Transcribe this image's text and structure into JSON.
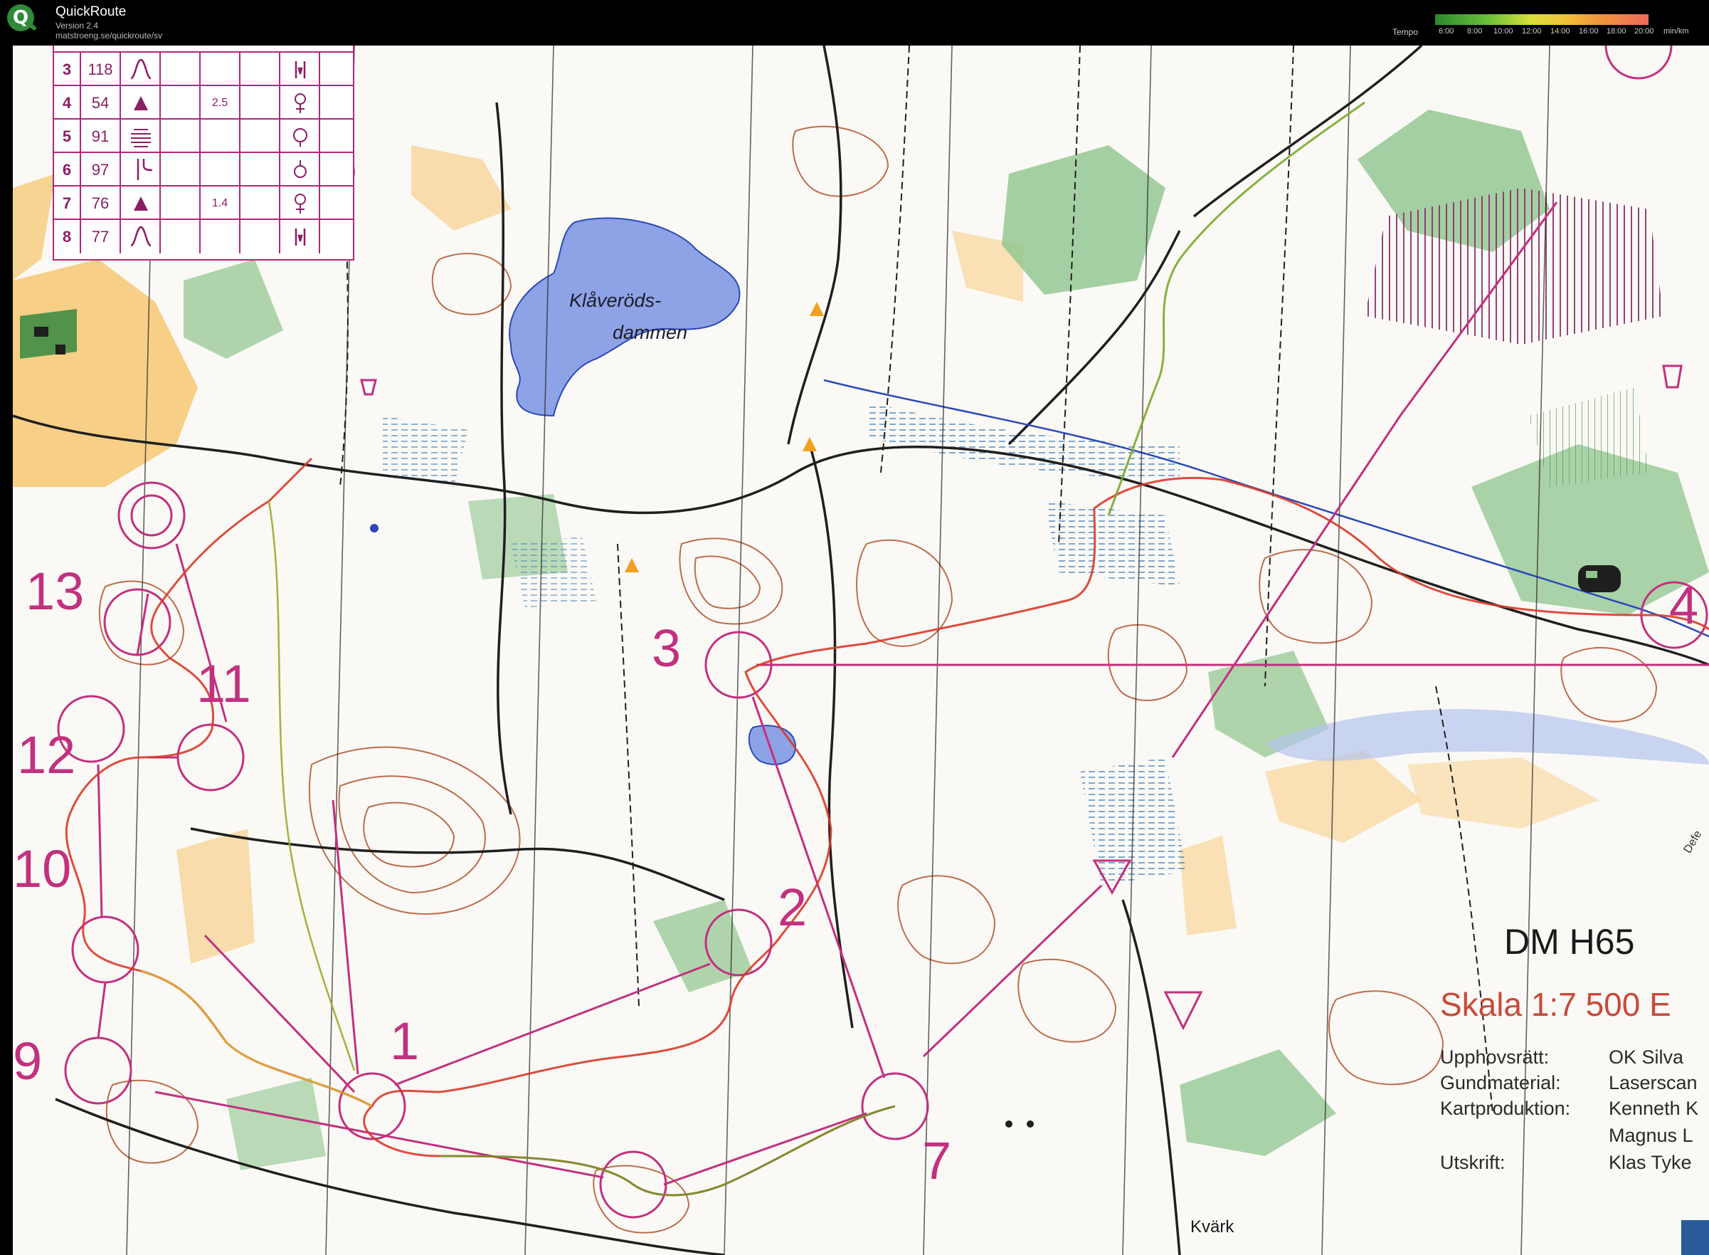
{
  "app": {
    "name": "QuickRoute",
    "version": "Version 2.4",
    "url": "matstroeng.se/quickroute/sv"
  },
  "tempo": {
    "label": "Tempo",
    "ticks": [
      "6:00",
      "8:00",
      "10:00",
      "12:00",
      "14:00",
      "16:00",
      "18:00",
      "20:00"
    ],
    "unit": "min/km"
  },
  "control_descriptions": [
    {
      "num": "3",
      "code": "118",
      "feature": "re-entrant",
      "dim": "",
      "loc": "earth-wall-pair"
    },
    {
      "num": "4",
      "code": "54",
      "feature": "boulder",
      "dim": "2.5",
      "loc": "foot"
    },
    {
      "num": "5",
      "code": "91",
      "feature": "marsh-lines",
      "dim": "",
      "loc": "circle"
    },
    {
      "num": "6",
      "code": "97",
      "feature": "path-junction",
      "dim": "",
      "loc": "ring"
    },
    {
      "num": "7",
      "code": "76",
      "feature": "boulder",
      "dim": "1.4",
      "loc": "foot"
    },
    {
      "num": "8",
      "code": "77",
      "feature": "re-entrant",
      "dim": "",
      "loc": "earth-wall-pair"
    }
  ],
  "map": {
    "lake": [
      "Klåveröds-",
      "dammen"
    ],
    "place": "Kvärk",
    "road_fragment": "Defe",
    "title": "DM H65",
    "scale": "Skala 1:7 500 E",
    "credits": [
      {
        "label": "Upphovsrätt:",
        "value": "OK Silva"
      },
      {
        "label": "Gundmaterial:",
        "value": "Laserscan"
      },
      {
        "label": "Kartproduktion:",
        "value": "Kenneth K"
      },
      {
        "label": "",
        "value": "Magnus L"
      },
      {
        "label": "Utskrift:",
        "value": "Klas Tyke"
      }
    ],
    "controls": [
      "1",
      "2",
      "3",
      "4",
      "7",
      "9",
      "10",
      "11",
      "12",
      "13"
    ]
  },
  "colors": {
    "overprint": "#c2307f",
    "contour": "#b0552e",
    "water": "#8ea2e6",
    "green": "#8fc48d",
    "orange": "#f4b860"
  }
}
